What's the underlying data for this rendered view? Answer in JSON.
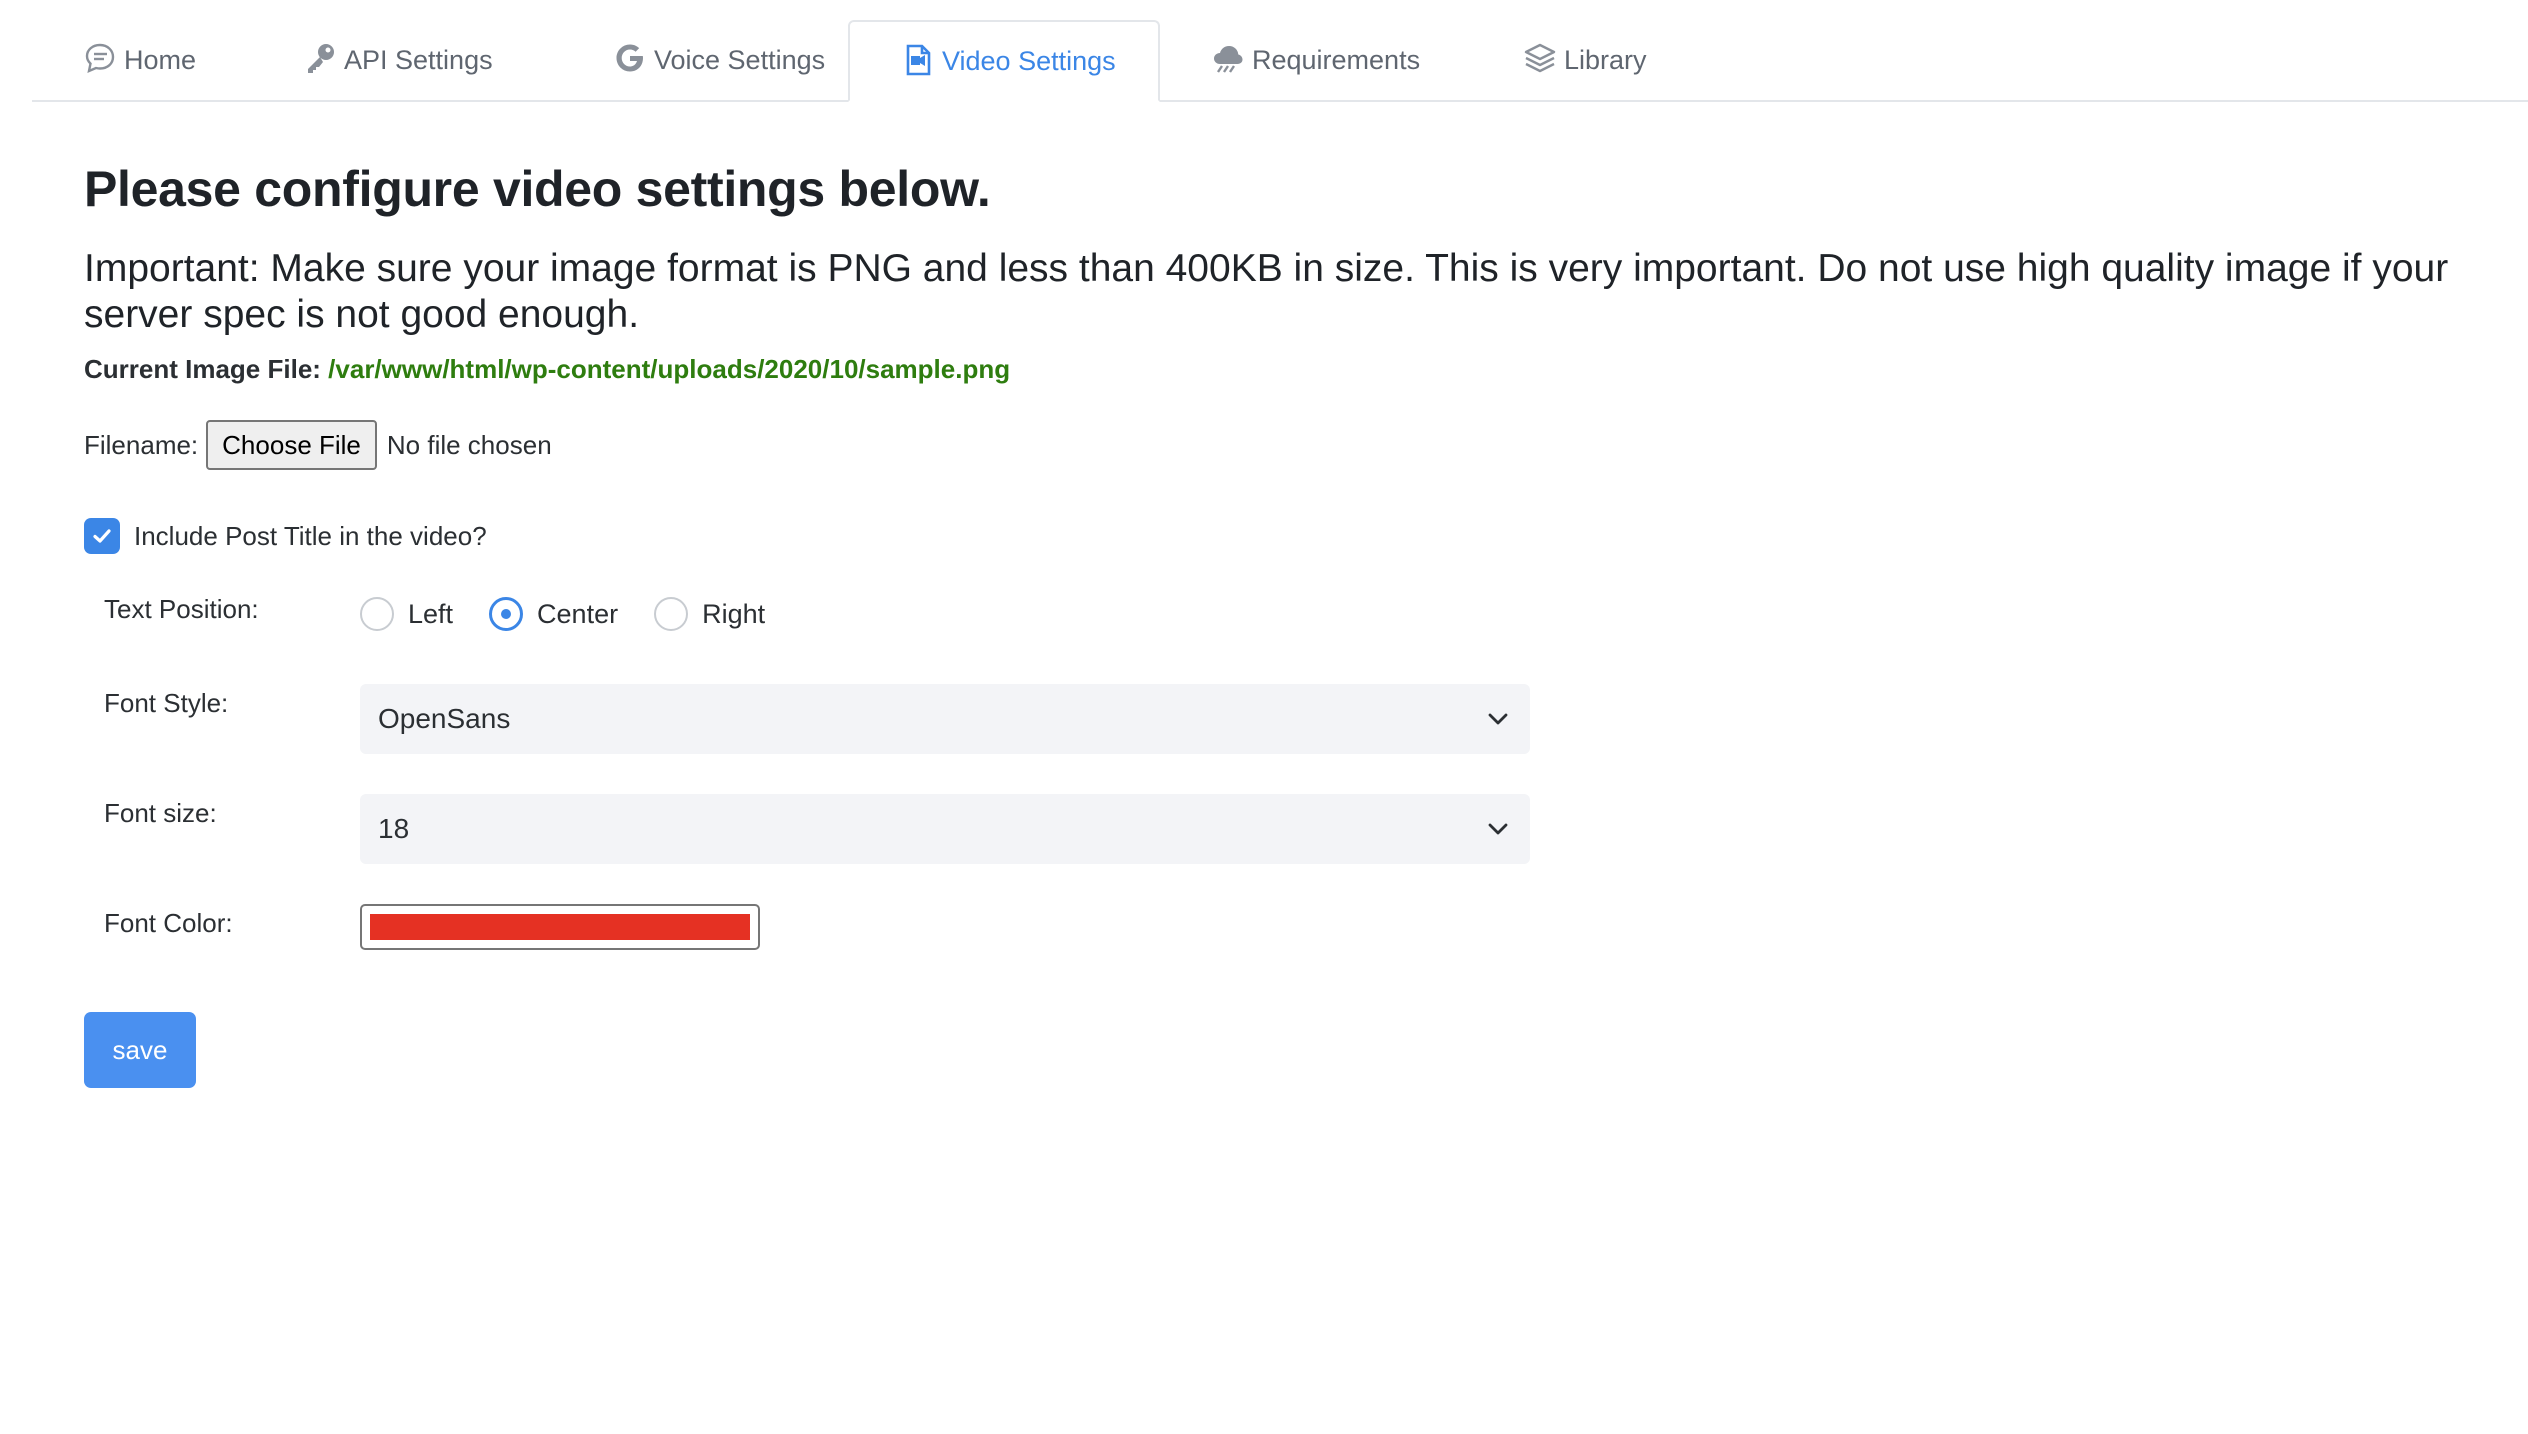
{
  "tabs": [
    {
      "label": "Home",
      "icon": "chat-bubble-icon"
    },
    {
      "label": "API Settings",
      "icon": "key-icon"
    },
    {
      "label": "Voice Settings",
      "icon": "google-g-icon"
    },
    {
      "label": "Video Settings",
      "icon": "video-file-icon",
      "active": true
    },
    {
      "label": "Requirements",
      "icon": "cloud-icon"
    },
    {
      "label": "Library",
      "icon": "layers-icon"
    }
  ],
  "main": {
    "title": "Please configure video settings below.",
    "important": "Important: Make sure your image format is PNG and less than 400KB in size. This is very important. Do not use high quality image if your server spec is not good enough.",
    "current_file_label": "Current Image File:",
    "current_file_path": "/var/www/html/wp-content/uploads/2020/10/sample.png",
    "filename_label": "Filename:",
    "choose_file_label": "Choose File",
    "no_file_text": "No file chosen",
    "include_title_label": "Include Post Title in the video?",
    "include_title_checked": true,
    "text_position_label": "Text Position:",
    "text_position_options": [
      "Left",
      "Center",
      "Right"
    ],
    "text_position_selected": "Center",
    "font_style_label": "Font Style:",
    "font_style_value": "OpenSans",
    "font_size_label": "Font size:",
    "font_size_value": "18",
    "font_color_label": "Font Color:",
    "font_color_value": "#e53123",
    "save_label": "save"
  },
  "colors": {
    "accent": "#3b86e6",
    "path_green": "#2e7d0f",
    "save_button": "#4a90f0"
  }
}
